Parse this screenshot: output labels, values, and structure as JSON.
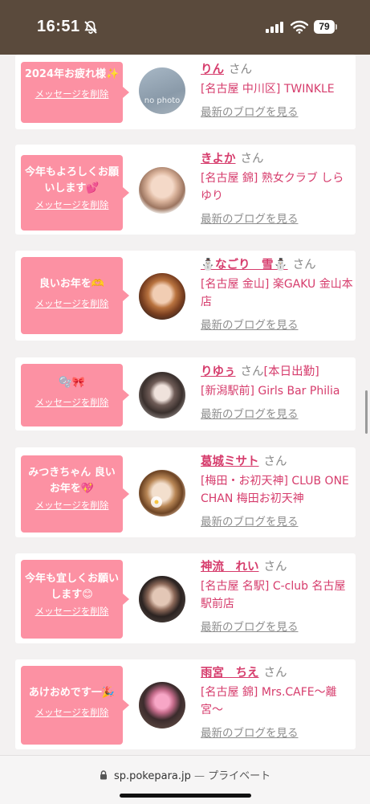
{
  "status": {
    "time": "16:51",
    "battery": "79"
  },
  "delete_label": "メッセージを削除",
  "blog_label": "最新のブログを見る",
  "san_label": "さん",
  "cards": [
    {
      "msg": "2024年お疲れ様✨",
      "name": "りん",
      "name_suffix": "",
      "shop": "[名古屋 中川区] TWINKLE"
    },
    {
      "msg": "今年もよろしくお願いします💕",
      "name": "きよか",
      "name_suffix": "",
      "shop": "[名古屋 錦] 熟女クラブ しらゆり"
    },
    {
      "msg": "良いお年を🫶",
      "name": "⛄なごり　雪⛄",
      "name_suffix": "",
      "shop": "[名古屋 金山] 楽GAKU 金山本店"
    },
    {
      "msg": "🫧🎀",
      "name": "りゆぅ",
      "name_suffix": "[本日出勤]",
      "shop": "[新潟駅前] Girls Bar Philia"
    },
    {
      "msg": "みつきちゃん 良いお年を💖",
      "name": "葛城ミサト",
      "name_suffix": "",
      "shop": "[梅田・お初天神] CLUB ONE CHAN 梅田お初天神"
    },
    {
      "msg": "今年も宜しくお願いします😊",
      "name": "神流　れい",
      "name_suffix": "",
      "shop": "[名古屋 名駅] C-club 名古屋駅前店"
    },
    {
      "msg": "あけおめです一🎉",
      "name": "雨宮　ちえ",
      "name_suffix": "",
      "shop": "[名古屋 錦] Mrs.CAFE〜離宮〜"
    }
  ],
  "browser": {
    "url": "sp.pokepara.jp",
    "separator": "—",
    "mode": "プライベート"
  }
}
